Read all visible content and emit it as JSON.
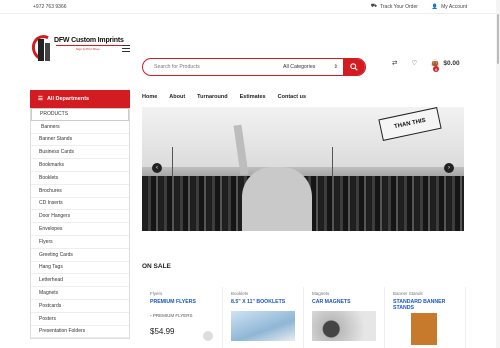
{
  "topbar": {
    "phone": "+972 763 9366",
    "track_order": "Track Your Order",
    "account": "My Account"
  },
  "header": {
    "logo_text": "DFW Custom Imprints",
    "logo_tagline": "Sign & Print Shop",
    "search_placeholder": "Search for Products",
    "category_select": "All Categories",
    "cart_total": "$0.00",
    "cart_count": "0"
  },
  "sidebar": {
    "title": "All Departments",
    "items": [
      "PRODUCTS",
      "Banners",
      "Banner Stands",
      "Business Cards",
      "Bookmarks",
      "Booklets",
      "Brochures",
      "CD Inserts",
      "Door Hangers",
      "Envelopes",
      "Flyers",
      "Greeting Cards",
      "Hang Tags",
      "Letterhead",
      "Magnets",
      "Postcards",
      "Posters",
      "Presentation Folders"
    ]
  },
  "nav": [
    "Home",
    "About",
    "Turnaround",
    "Estimates",
    "Contact us"
  ],
  "hero": {
    "sign_text": "THAN THIS"
  },
  "section_title": "ON SALE",
  "products": [
    {
      "category": "Flyers",
      "name": "PREMIUM FLYERS",
      "img_alt": "PREMIUM FLYERS",
      "price": "$54.99"
    },
    {
      "category": "Booklets",
      "name": "8.5\" X 11\" BOOKLETS",
      "price": ""
    },
    {
      "category": "Magnets",
      "name": "CAR MAGNETS",
      "price": ""
    },
    {
      "category": "Banner Stands",
      "name": "STANDARD BANNER STANDS",
      "price": ""
    }
  ],
  "colors": {
    "accent": "#d21c22",
    "link": "#1a57c4"
  }
}
